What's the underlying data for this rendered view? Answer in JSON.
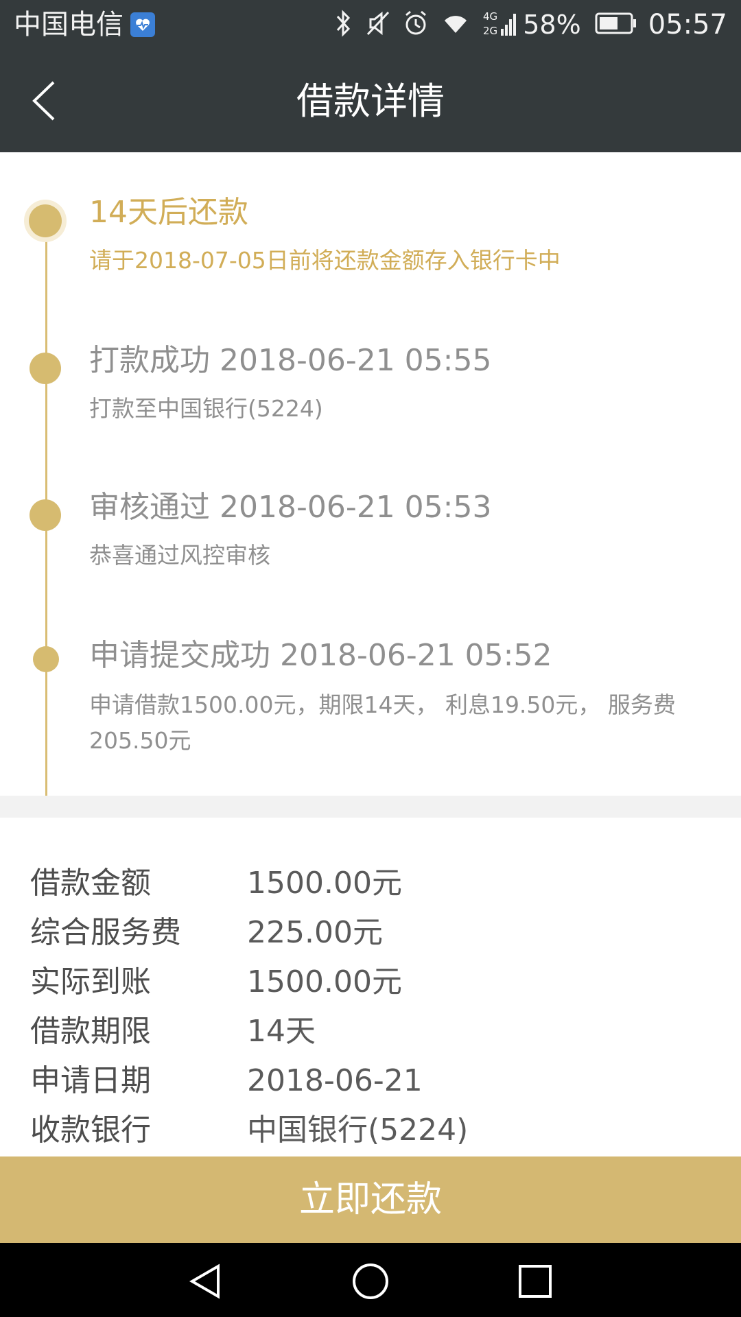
{
  "status_bar": {
    "carrier": "中国电信",
    "network": "4G 2G",
    "battery": "58%",
    "time": "05:57",
    "icons": [
      "health-icon",
      "bluetooth-icon",
      "mute-icon",
      "alarm-icon",
      "wifi-icon",
      "signal-icon",
      "battery-icon"
    ]
  },
  "header": {
    "title": "借款详情",
    "back_icon": "chevron-left-icon"
  },
  "timeline": [
    {
      "title": "14天后还款",
      "subtitle": "请于2018-07-05日前将还款金额存入银行卡中",
      "active": true
    },
    {
      "title": "打款成功 2018-06-21 05:55",
      "subtitle": "打款至中国银行(5224)",
      "active": false
    },
    {
      "title": "审核通过 2018-06-21 05:53",
      "subtitle": "恭喜通过风控审核",
      "active": false
    },
    {
      "title": "申请提交成功 2018-06-21 05:52",
      "subtitle": "申请借款1500.00元，期限14天， 利息19.50元， 服务费205.50元",
      "active": false
    }
  ],
  "details": [
    {
      "label": "借款金额",
      "value": "1500.00元"
    },
    {
      "label": "综合服务费",
      "value": "225.00元"
    },
    {
      "label": "实际到账",
      "value": "1500.00元"
    },
    {
      "label": "借款期限",
      "value": "14天"
    },
    {
      "label": "申请日期",
      "value": "2018-06-21"
    },
    {
      "label": "收款银行",
      "value": "中国银行(5224)"
    }
  ],
  "actions": {
    "repay_label": "立即还款"
  },
  "colors": {
    "header_bg": "#343a3c",
    "accent_gold": "#d4b872",
    "active_text": "#d1ad57"
  }
}
